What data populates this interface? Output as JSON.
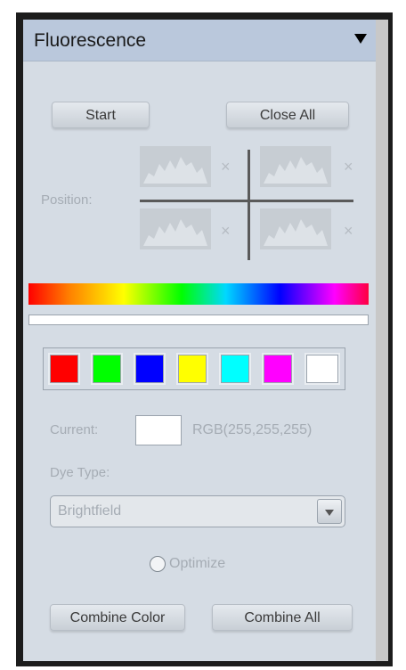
{
  "panel": {
    "title": "Fluorescence",
    "collapse_icon": "triangle-down-icon"
  },
  "buttons": {
    "start": "Start",
    "close_all": "Close All",
    "combine_color": "Combine Color",
    "combine_all": "Combine All"
  },
  "position": {
    "label": "Position:",
    "close_glyph": "×"
  },
  "swatches": [
    {
      "name": "red",
      "color": "#ff0000"
    },
    {
      "name": "green",
      "color": "#00ff00"
    },
    {
      "name": "blue",
      "color": "#0000ff"
    },
    {
      "name": "yellow",
      "color": "#ffff00"
    },
    {
      "name": "cyan",
      "color": "#00ffff"
    },
    {
      "name": "magenta",
      "color": "#ff00ff"
    },
    {
      "name": "white",
      "color": "#ffffff"
    }
  ],
  "current": {
    "label": "Current:",
    "rgb": "RGB(255,255,255)",
    "color": "#ffffff"
  },
  "dye": {
    "label": "Dye Type:",
    "value": "Brightfield"
  },
  "optimize": {
    "label": "Optimize",
    "checked": false
  }
}
